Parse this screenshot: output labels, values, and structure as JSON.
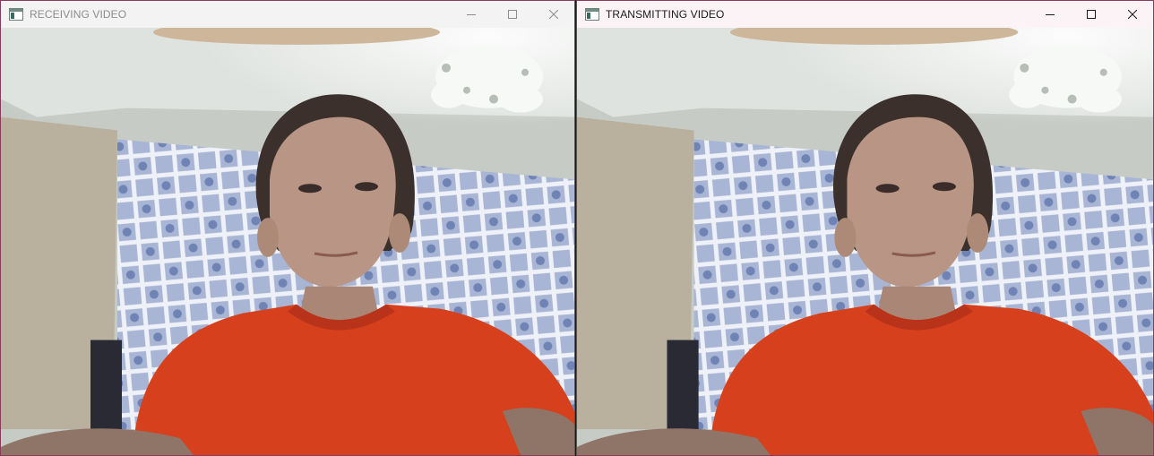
{
  "windows": [
    {
      "title": "RECEIVING VIDEO",
      "icon": "app-window-icon",
      "controls": [
        "minimize-icon",
        "maximize-icon",
        "close-icon"
      ]
    },
    {
      "title": "TRANSMITTING VIDEO",
      "icon": "app-window-icon",
      "controls": [
        "minimize-icon",
        "maximize-icon",
        "close-icon"
      ]
    }
  ],
  "colors": {
    "wall": "#c9cdc9",
    "ceiling": "#dfe3df",
    "wallpaper": "#9aa7c8",
    "cabinet": "#b8ae9b",
    "shirt": "#d9411d",
    "skin": "#b79482",
    "hair": "#3a2f2a",
    "lamp": "#f4f7f4"
  }
}
